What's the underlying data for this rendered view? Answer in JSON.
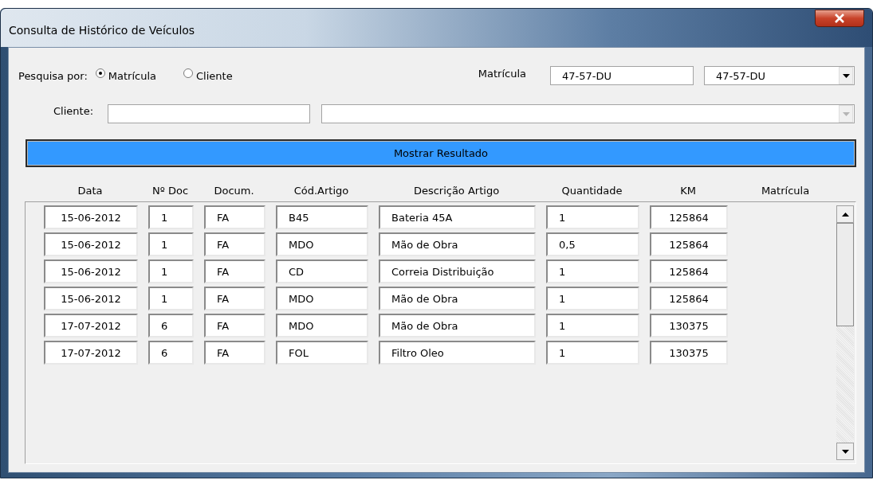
{
  "window": {
    "title": "Consulta de Histórico de Veículos"
  },
  "search": {
    "label": "Pesquisa por:",
    "options": [
      {
        "label": "Matrícula",
        "selected": true
      },
      {
        "label": "Cliente",
        "selected": false
      }
    ],
    "plate_label": "Matrícula",
    "plate_value": "47-57-DU",
    "plate_combo": "47-57-DU",
    "client_label": "Cliente:",
    "client_combo_disabled": true
  },
  "show_button": "Mostrar Resultado",
  "table": {
    "columns": [
      "Data",
      "Nº Doc",
      "Docum.",
      "Cód.Artigo",
      "Descrição Artigo",
      "Quantidade",
      "KM",
      "Matrícula"
    ],
    "rows": [
      [
        "15-06-2012",
        "1",
        "FA",
        "B45",
        "Bateria 45A",
        "1",
        "125864"
      ],
      [
        "15-06-2012",
        "1",
        "FA",
        "MDO",
        "Mão de Obra",
        "0,5",
        "125864"
      ],
      [
        "15-06-2012",
        "1",
        "FA",
        "CD",
        "Correia Distribuição",
        "1",
        "125864"
      ],
      [
        "15-06-2012",
        "1",
        "FA",
        "MDO",
        "Mão de Obra",
        "1",
        "125864"
      ],
      [
        "17-07-2012",
        "6",
        "FA",
        "MDO",
        "Mão de Obra",
        "1",
        "130375"
      ],
      [
        "17-07-2012",
        "6",
        "FA",
        "FOL",
        "Filtro Oleo",
        "1",
        "130375"
      ]
    ]
  }
}
